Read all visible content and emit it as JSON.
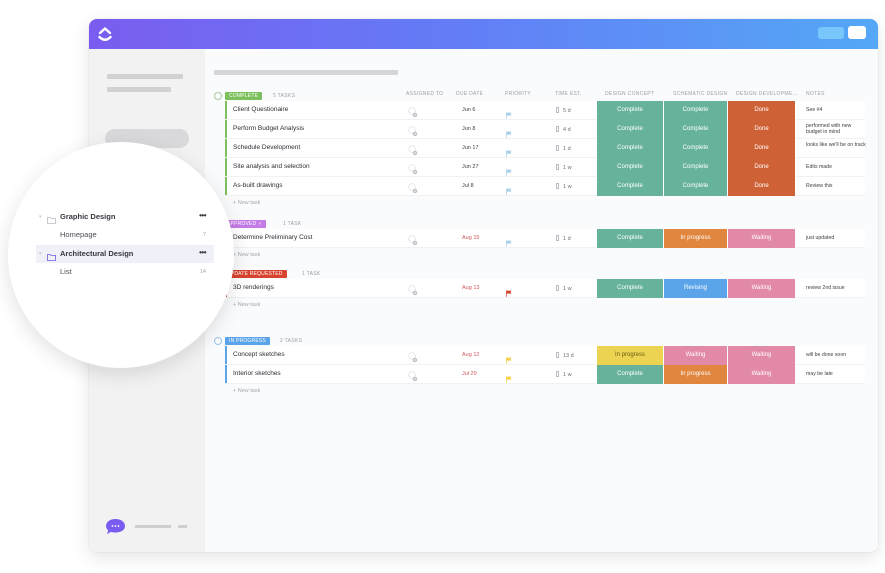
{
  "app": {
    "brand_color": "#7b5cf0"
  },
  "columns": {
    "assigned_to": "ASSIGNED TO",
    "due_date": "DUE DATE",
    "priority": "PRIORITY",
    "time_est": "TIME EST.",
    "design_concept": "DESIGN CONCEPT",
    "schematic_design": "SCHEMATIC DESIGN",
    "design_development": "DESIGN DEVELOPME...",
    "notes": "NOTES"
  },
  "status_colors": {
    "Complete": "#67b29b",
    "Done": "#cf6136",
    "In progress": "#e0863e",
    "Waiting": "#e289a8",
    "Revising": "#5ba4ea",
    "In progress (yellow)": "#ecd452"
  },
  "groups": [
    {
      "status": "COMPLETE",
      "color": "#7cc05b",
      "count": "5 TASKS",
      "new_task": "+ New task",
      "tasks": [
        {
          "name": "Client Questionaire",
          "due": "Jun 6",
          "due_overdue": false,
          "priority": "low",
          "time": "5 d",
          "concept": "Complete",
          "schematic": "Complete",
          "development": "Done",
          "note": "See #4"
        },
        {
          "name": "Perform Budget Analysis",
          "due": "Jun 8",
          "due_overdue": false,
          "priority": "low",
          "time": "4 d",
          "concept": "Complete",
          "schematic": "Complete",
          "development": "Done",
          "note": "performed with new budget in mind"
        },
        {
          "name": "Schedule Development",
          "due": "Jun 17",
          "due_overdue": false,
          "priority": "low",
          "time": "1 d",
          "concept": "Complete",
          "schematic": "Complete",
          "development": "Done",
          "note": "looks like we'll be on track"
        },
        {
          "name": "Site analysis and selection",
          "due": "Jun 27",
          "due_overdue": false,
          "priority": "low",
          "time": "1 w",
          "concept": "Complete",
          "schematic": "Complete",
          "development": "Done",
          "note": "Edits made"
        },
        {
          "name": "As-built drawings",
          "due": "Jul 8",
          "due_overdue": false,
          "priority": "low",
          "time": "1 w",
          "concept": "Complete",
          "schematic": "Complete",
          "development": "Done",
          "note": "Review this"
        }
      ]
    },
    {
      "status": "APPROVED ✓",
      "color": "#c57be6",
      "count": "1 TASK",
      "new_task": "+ New task",
      "tasks": [
        {
          "name": "Determine Preliminary Cost",
          "due": "Aug 15",
          "due_overdue": true,
          "priority": "low",
          "time": "1 d",
          "concept": "Complete",
          "schematic": "In progress",
          "development": "Waiting",
          "note": "just updated"
        }
      ]
    },
    {
      "status": "UPDATE REQUESTED",
      "color": "#d8432f",
      "count": "1 TASK",
      "new_task": "+ New task",
      "tasks": [
        {
          "name": "3D renderings",
          "due": "Aug 13",
          "due_overdue": true,
          "priority": "urgent",
          "time": "1 w",
          "concept": "Complete",
          "schematic": "Revising",
          "development": "Waiting",
          "note": "review 2nd issue"
        }
      ]
    },
    {
      "status": "IN PROGRESS",
      "color": "#5ba4ea",
      "count": "2 TASKS",
      "new_task": "+ New task",
      "tasks": [
        {
          "name": "Concept sketches",
          "due": "Aug 12",
          "due_overdue": true,
          "priority": "normal",
          "time": "13 d",
          "concept": "In progress",
          "schematic": "Waiting",
          "development": "Waiting",
          "note": "will be done soon"
        },
        {
          "name": "Interior sketches",
          "due": "Jul 29",
          "due_overdue": true,
          "priority": "normal",
          "time": "1 w",
          "concept": "Complete",
          "schematic": "In progress",
          "development": "Waiting",
          "note": "may be late"
        }
      ]
    }
  ],
  "sidebar_zoom": {
    "items": [
      {
        "label": "Graphic Design",
        "type": "folder",
        "active": false
      },
      {
        "label": "Homepage",
        "type": "list",
        "count": "7"
      },
      {
        "label": "Architectural Design",
        "type": "folder",
        "active": true
      },
      {
        "label": "List",
        "type": "list",
        "count": "14"
      }
    ],
    "more_label": "•••",
    "caret": "▾"
  }
}
